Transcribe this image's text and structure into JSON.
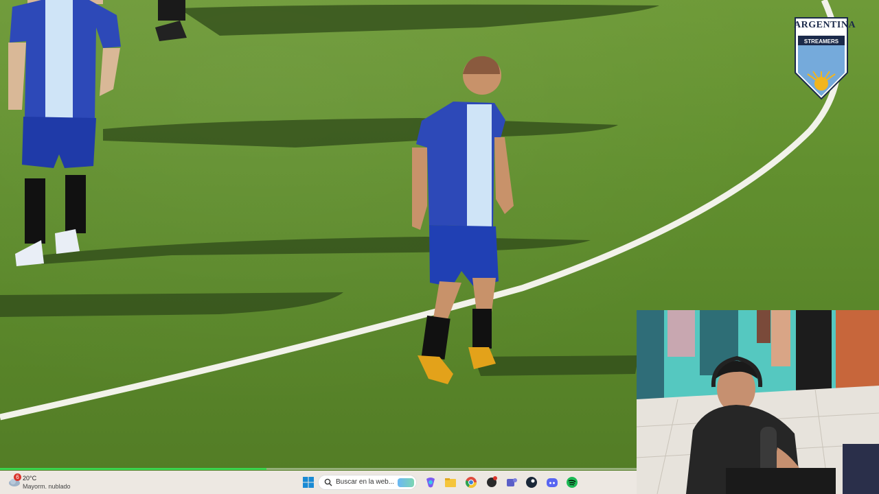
{
  "overlay": {
    "logo_line1": "ARGENTINA",
    "logo_line2": "STREAMERS"
  },
  "taskbar": {
    "weather": {
      "badge": "6",
      "temp": "20°C",
      "condition": "Mayorm. nublado"
    },
    "search_placeholder": "Buscar en la web...",
    "icons": [
      "windows-start-icon",
      "search-icon",
      "copilot-icon",
      "file-explorer-icon",
      "chrome-icon",
      "settings-app-icon",
      "teams-icon",
      "steam-icon",
      "discord-icon",
      "spotify-icon"
    ]
  },
  "colors": {
    "kit_blue": "#2d49b8",
    "kit_sky": "#cfe4f7",
    "progress": "#3ad64f"
  }
}
